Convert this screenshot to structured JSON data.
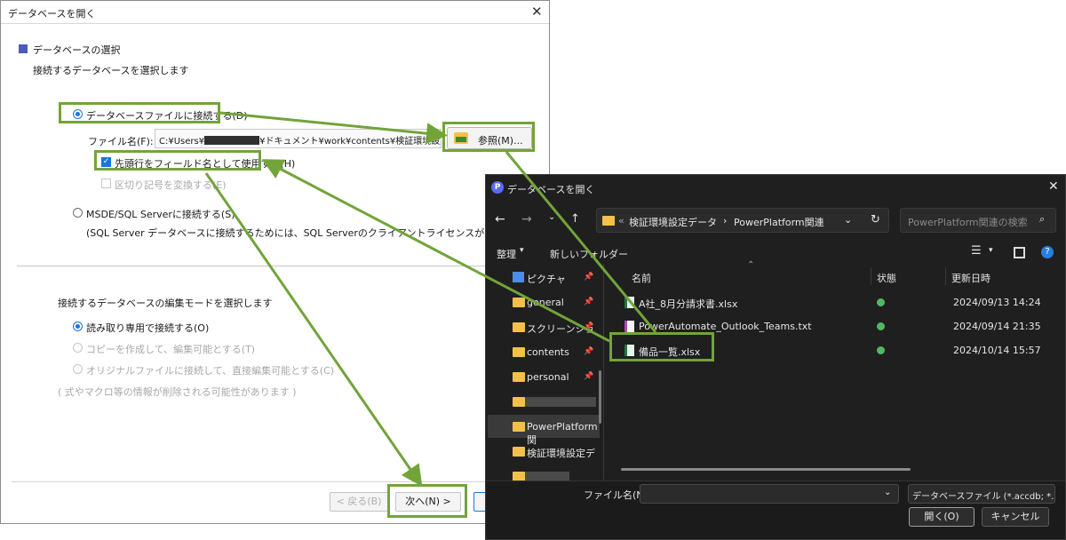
{
  "dialog_open_db": {
    "title": "データベースを開く",
    "section_title": "データベースの選択",
    "section_subtitle": "接続するデータベースを選択します",
    "radio_file": "データベースファイルに接続する(D)",
    "file_name_label": "ファイル名(F):",
    "file_path_prefix": "C:¥Users¥",
    "file_path_suffix": "¥ドキュメント¥work¥contents¥検証環境設定データ",
    "browse_button": "参照(M)...",
    "checkbox_first_row": "先頭行をフィールド名として使用する(H)",
    "checkbox_convert_delimiters": "区切り記号を変換する(E)",
    "radio_sql_server": "MSDE/SQL Serverに接続する(S)",
    "sql_server_note": "(SQL Server データベースに接続するためには、SQL Serverのクライアントライセンスが必要です)",
    "edit_mode_title": "接続するデータベースの編集モードを選択します",
    "mode_readonly": "読み取り専用で接続する(O)",
    "mode_copy": "コピーを作成して、編集可能とする(T)",
    "mode_original": "オリジナルファイルに接続して、直接編集可能とする(C)",
    "mode_note": "( 式やマクロ等の情報が削除される可能性があります )",
    "back_button": "< 戻る(B)",
    "next_button": "次へ(N) >"
  },
  "file_picker": {
    "title": "データベースを開く",
    "breadcrumb_prefix": "«",
    "breadcrumb": [
      "検証環境設定データ",
      "PowerPlatform関連"
    ],
    "search_placeholder": "PowerPlatform関連の検索",
    "organize": "整理",
    "new_folder": "新しいフォルダー",
    "sidebar": [
      "ピクチャ",
      "general",
      "スクリーンショ",
      "contents",
      "personal",
      "",
      "PowerPlatform関",
      "検証環境設定デ",
      ""
    ],
    "columns": {
      "name": "名前",
      "status": "状態",
      "modified": "更新日時"
    },
    "files": [
      {
        "name": "A社_8月分請求書.xlsx",
        "modified": "2024/09/13 14:24"
      },
      {
        "name": "PowerAutomate_Outlook_Teams.txt",
        "modified": "2024/09/14 21:35"
      },
      {
        "name": "備品一覧.xlsx",
        "modified": "2024/10/14 15:57"
      }
    ],
    "file_name_label": "ファイル名(N):",
    "file_type": "データベースファイル (*.accdb; *.md",
    "open_button": "開く(O)",
    "cancel_button": "キャンセル"
  },
  "colors": {
    "highlight": "#72a43a",
    "dark_bg": "#1f1f1f",
    "accent": "#1a73e8"
  }
}
